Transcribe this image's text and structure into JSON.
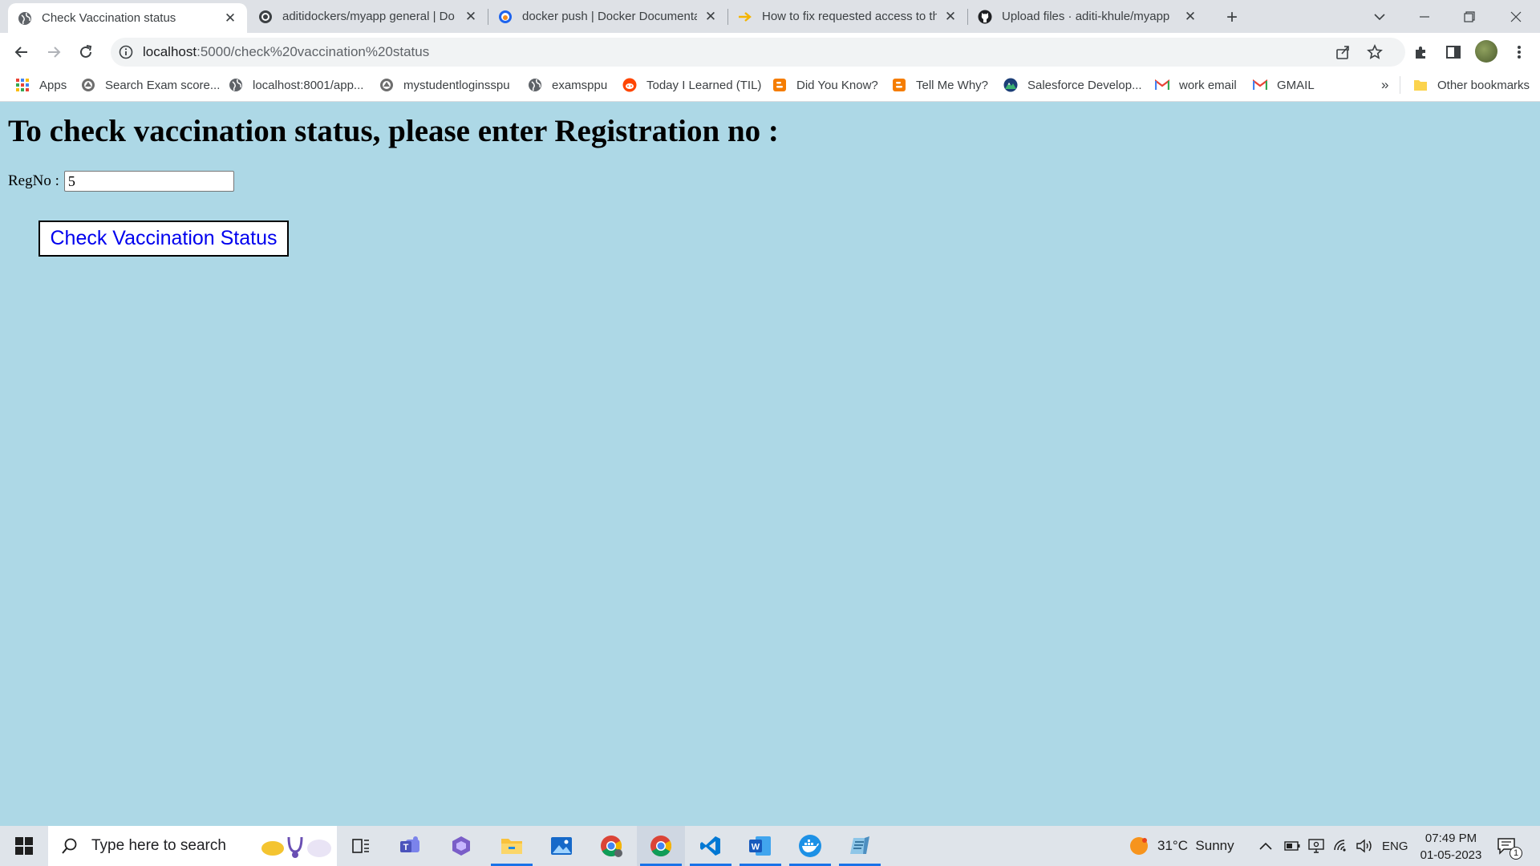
{
  "browser": {
    "tabs": [
      {
        "title": "Check Vaccination status",
        "icon": "globe-icon",
        "active": true
      },
      {
        "title": "aditidockers/myapp general | Do",
        "icon": "docker-hub-icon",
        "active": false
      },
      {
        "title": "docker push | Docker Documenta",
        "icon": "docker-docs-icon",
        "active": false
      },
      {
        "title": "How to fix requested access to th",
        "icon": "arrow-site-icon",
        "active": false
      },
      {
        "title": "Upload files · aditi-khule/myapp",
        "icon": "github-icon",
        "active": false
      }
    ],
    "new_tab": "+",
    "url_host": "localhost",
    "url_rest": ":5000/check%20vaccination%20status",
    "bookmarks": [
      {
        "label": "Apps",
        "icon": "apps-grid-icon"
      },
      {
        "label": "Search Exam score...",
        "icon": "university-seal-icon"
      },
      {
        "label": "localhost:8001/app...",
        "icon": "globe-icon"
      },
      {
        "label": "mystudentloginsspu",
        "icon": "university-seal-icon"
      },
      {
        "label": "examsppu",
        "icon": "globe-icon"
      },
      {
        "label": "Today I Learned (TIL)",
        "icon": "reddit-icon"
      },
      {
        "label": "Did You Know?",
        "icon": "blogger-icon"
      },
      {
        "label": "Tell Me Why?",
        "icon": "blogger-icon"
      },
      {
        "label": "Salesforce Develop...",
        "icon": "trailhead-icon"
      },
      {
        "label": "work email",
        "icon": "gmail-icon"
      },
      {
        "label": "GMAIL",
        "icon": "gmail-icon"
      }
    ],
    "bookmarks_overflow": "»",
    "other_bookmarks": "Other bookmarks"
  },
  "page": {
    "heading": "To check vaccination status, please enter Registration no :",
    "regno_label": "RegNo :",
    "regno_value": "5",
    "submit_label": "Check Vaccination Status"
  },
  "taskbar": {
    "search_placeholder": "Type here to search",
    "weather": "31°C  Sunny",
    "language": "ENG",
    "time": "07:49 PM",
    "date": "01-05-2023",
    "notification_count": "1"
  },
  "colors": {
    "page_background": "#add8e6",
    "link_blue": "#0000ee",
    "tab_strip": "#dee1e6"
  }
}
